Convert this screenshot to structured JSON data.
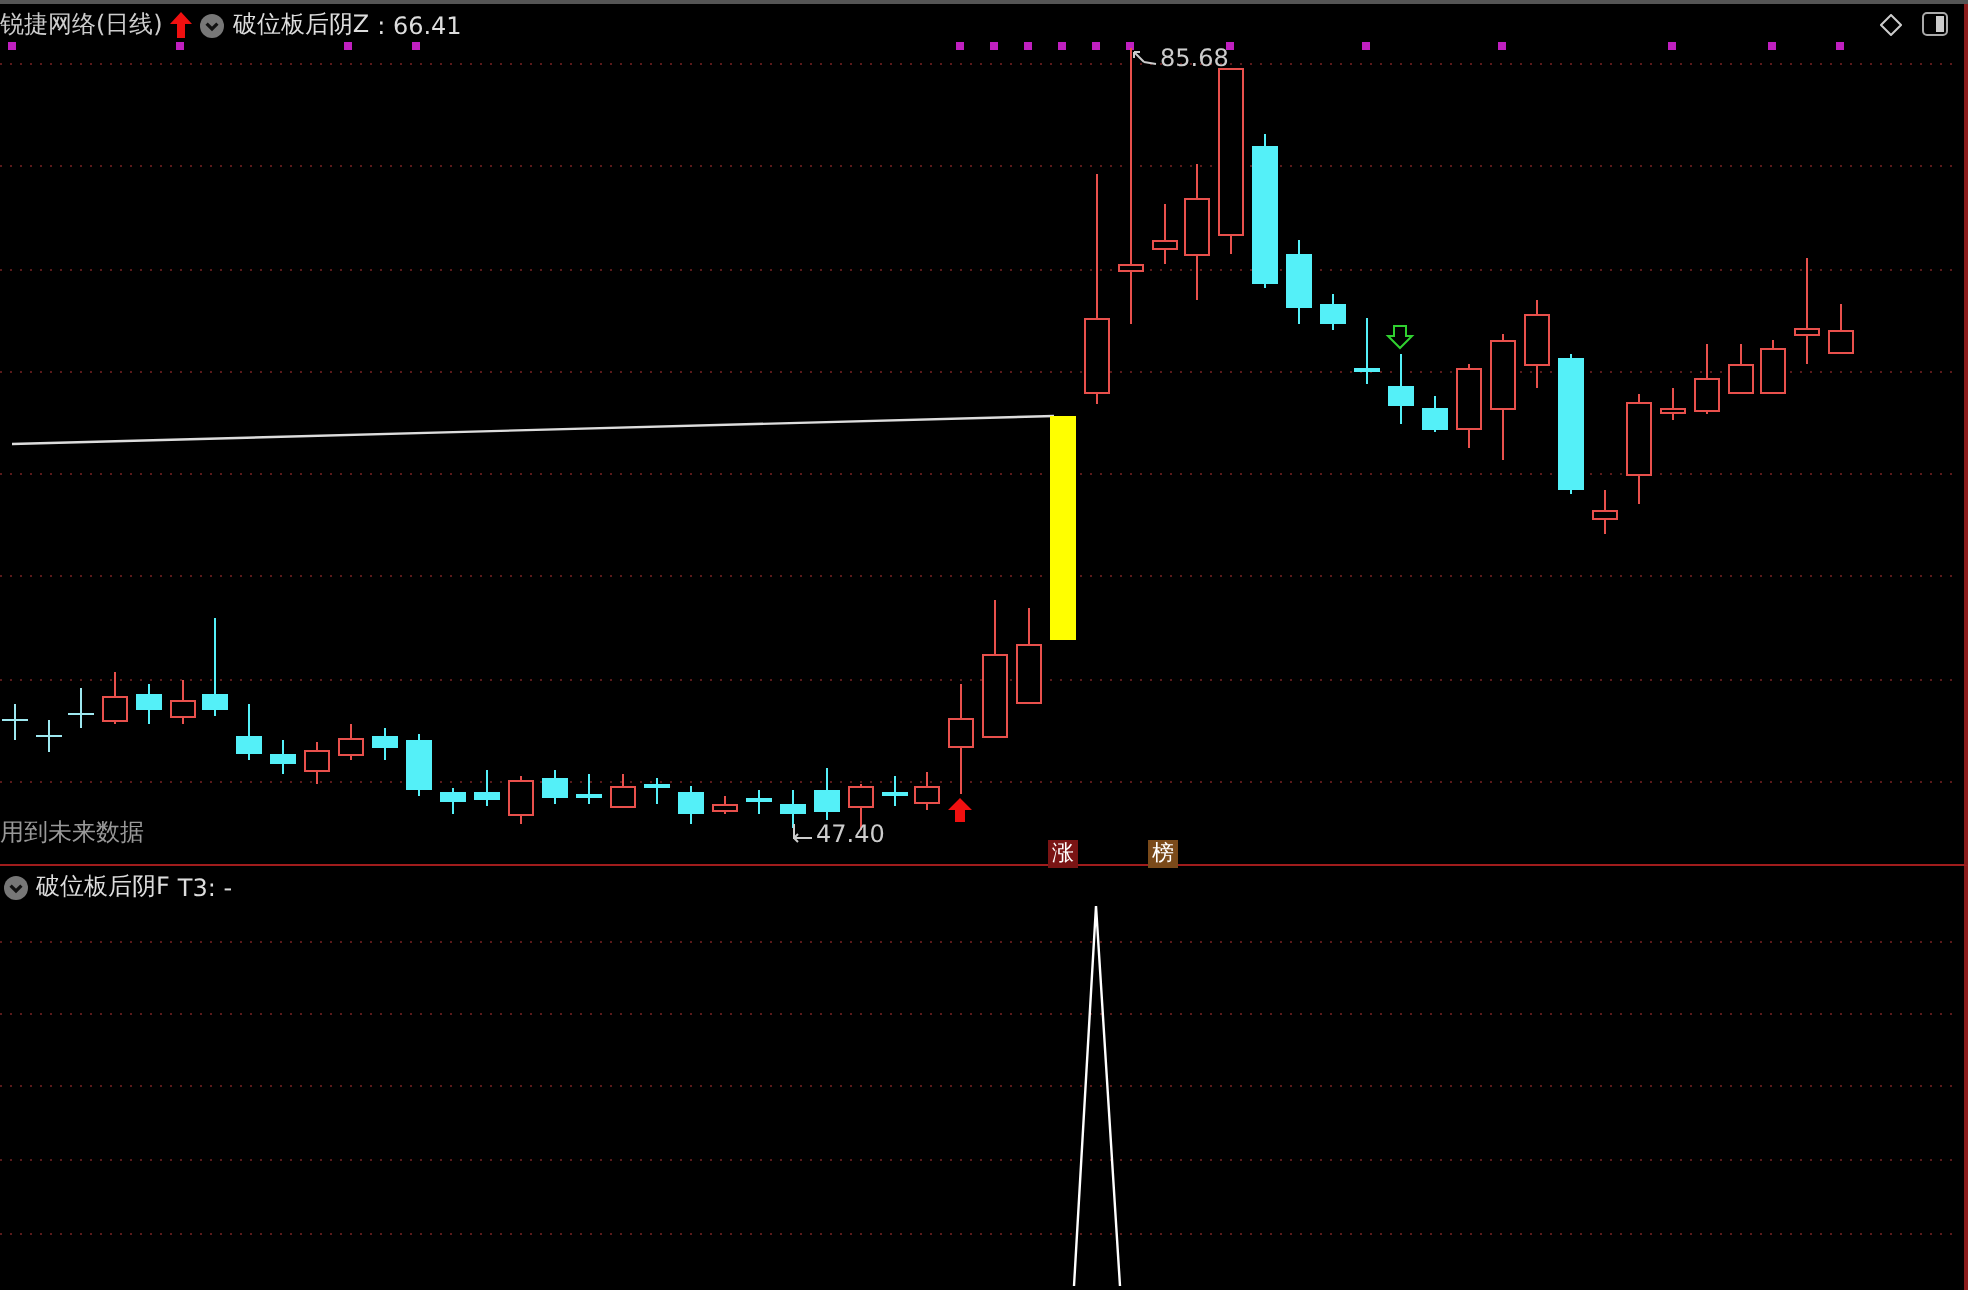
{
  "header": {
    "stock": "锐捷网络(日线)",
    "indicator": "破位板后阴Z",
    "value": ": 66.41"
  },
  "price_labels": {
    "high": "85.68",
    "low": "47.40"
  },
  "warning": "用到未来数据",
  "tags": [
    {
      "text": "涨",
      "kind": "rise"
    },
    {
      "text": "榜",
      "kind": "rank"
    }
  ],
  "lower_pane": {
    "indicator": "破位板后阴F",
    "value": "T3: -"
  }
}
